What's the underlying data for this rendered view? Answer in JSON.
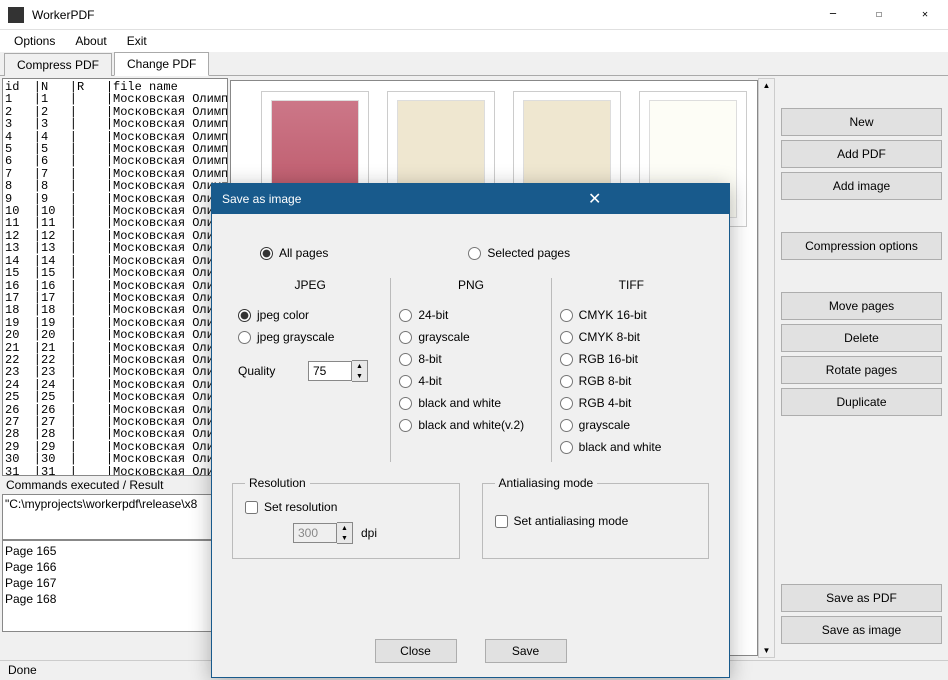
{
  "app": {
    "title": "WorkerPDF"
  },
  "menu": {
    "options": "Options",
    "about": "About",
    "exit": "Exit"
  },
  "tabs": {
    "compress": "Compress PDF",
    "change": "Change PDF"
  },
  "table": {
    "header": "id  |N   |R   |file name",
    "rowPrefix": "Московская Олимпиа",
    "count": 31
  },
  "commands": {
    "label": "Commands executed / Result",
    "exec": "\"C:\\myprojects\\workerpdf\\release\\x8",
    "results": [
      "Page 165",
      "Page 166",
      "Page 167",
      "Page 168"
    ]
  },
  "sidebar": {
    "new": "New",
    "addPdf": "Add PDF",
    "addImage": "Add image",
    "compOpt": "Compression options",
    "movePages": "Move pages",
    "delete": "Delete",
    "rotate": "Rotate pages",
    "duplicate": "Duplicate",
    "saveAsPdf": "Save as PDF",
    "saveAsImage": "Save as image"
  },
  "status": "Done",
  "modal": {
    "title": "Save as image",
    "allPages": "All pages",
    "selectedPages": "Selected pages",
    "jpeg": {
      "title": "JPEG",
      "color": "jpeg color",
      "gray": "jpeg grayscale",
      "quality": "Quality",
      "qval": "75"
    },
    "png": {
      "title": "PNG",
      "b24": "24-bit",
      "gray": "grayscale",
      "b8": "8-bit",
      "b4": "4-bit",
      "bw": "black and white",
      "bw2": "black and white(v.2)"
    },
    "tiff": {
      "title": "TIFF",
      "c16": "CMYK 16-bit",
      "c8": "CMYK 8-bit",
      "r16": "RGB 16-bit",
      "r8": "RGB 8-bit",
      "r4": "RGB 4-bit",
      "gray": "grayscale",
      "bw": "black and white"
    },
    "res": {
      "legend": "Resolution",
      "set": "Set resolution",
      "val": "300",
      "unit": "dpi"
    },
    "aa": {
      "legend": "Antialiasing mode",
      "set": "Set antialiasing mode"
    },
    "close": "Close",
    "save": "Save"
  }
}
